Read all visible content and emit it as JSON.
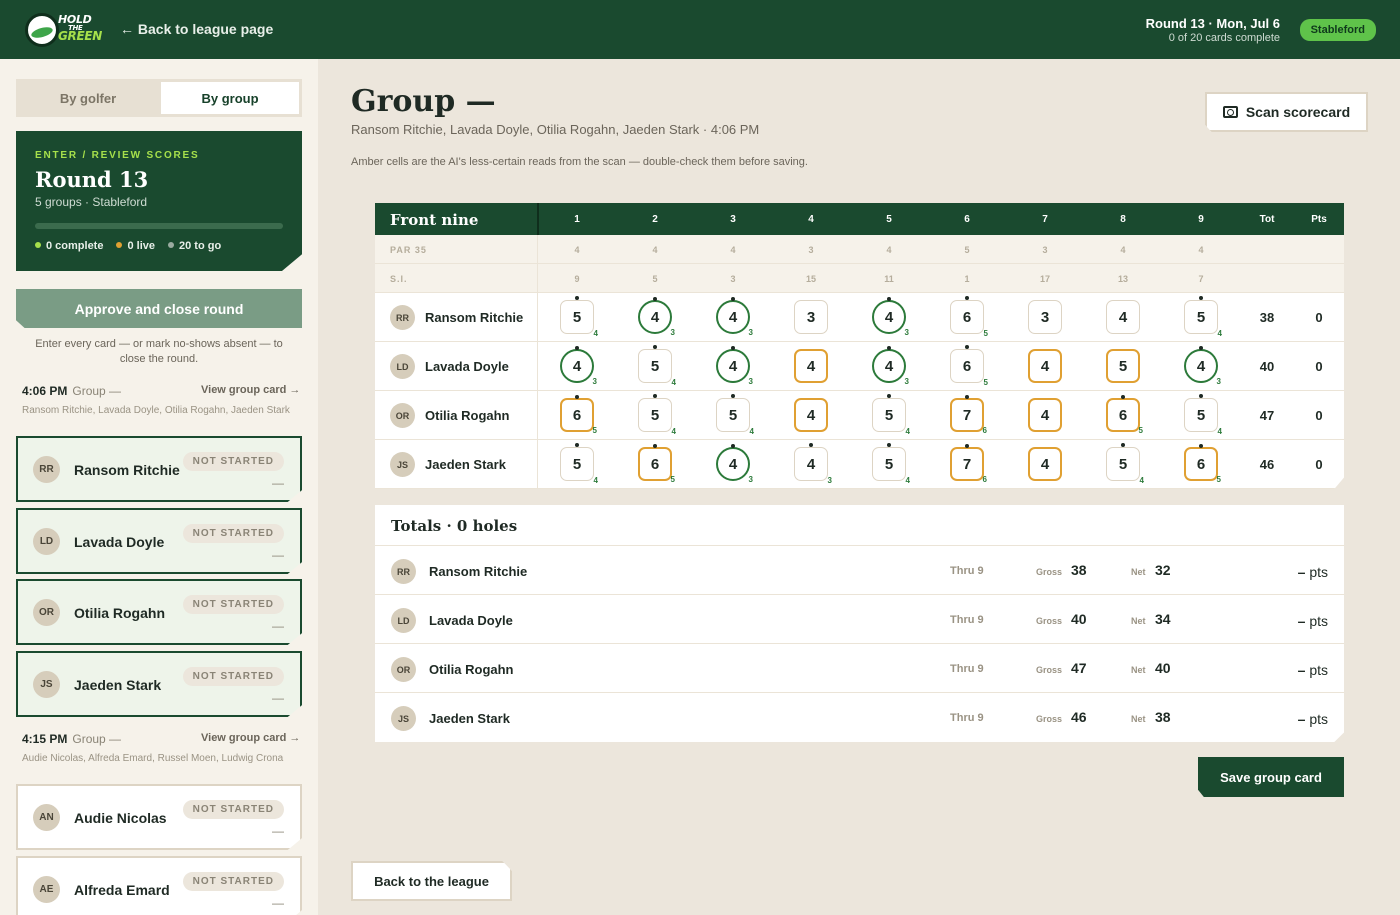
{
  "topbar": {
    "logo": {
      "line1": "HOLD",
      "line2": "THE",
      "line3": "GREEN"
    },
    "back_label": "← Back to league page",
    "round_title": "Round 13 · Mon, Jul 6",
    "round_sub": "0 of 20 cards complete",
    "format_pill": "Stableford"
  },
  "sidebar": {
    "tabs": [
      {
        "label": "By golfer",
        "selected": false
      },
      {
        "label": "By group",
        "selected": true
      }
    ],
    "round_card": {
      "kicker": "ENTER / REVIEW SCORES",
      "title": "Round 13",
      "subtitle": "5 groups · Stableford",
      "progress": 0,
      "stats": [
        {
          "label": "0 complete",
          "color": "#a6e04b"
        },
        {
          "label": "0 live",
          "color": "#e0a032"
        },
        {
          "label": "20 to go",
          "color": "#9aaba0"
        }
      ]
    },
    "approve_label": "Approve and close round",
    "approve_note": "Enter every card — or mark no-shows absent — to close the round.",
    "groups": [
      {
        "time": "4:06 PM",
        "label": "Group —",
        "view": "View group card →",
        "names": "Ransom Ritchie, Lavada Doyle, Otilia Rogahn, Jaeden Stark",
        "players": [
          {
            "initials": "RR",
            "name": "Ransom Ritchie",
            "status": "NOT STARTED",
            "dash": "—"
          },
          {
            "initials": "LD",
            "name": "Lavada Doyle",
            "status": "NOT STARTED",
            "dash": "—"
          },
          {
            "initials": "OR",
            "name": "Otilia Rogahn",
            "status": "NOT STARTED",
            "dash": "—"
          },
          {
            "initials": "JS",
            "name": "Jaeden Stark",
            "status": "NOT STARTED",
            "dash": "—"
          }
        ]
      },
      {
        "time": "4:15 PM",
        "label": "Group —",
        "view": "View group card →",
        "names": "Audie Nicolas, Alfreda Emard, Russel Moen, Ludwig Crona",
        "players": [
          {
            "initials": "AN",
            "name": "Audie Nicolas",
            "status": "NOT STARTED",
            "dash": "—"
          },
          {
            "initials": "AE",
            "name": "Alfreda Emard",
            "status": "NOT STARTED",
            "dash": "—"
          }
        ]
      }
    ]
  },
  "main": {
    "title": "Group —",
    "subtitle": "Ransom Ritchie, Lavada Doyle, Otilia Rogahn, Jaeden Stark · 4:06 PM",
    "note": "Amber cells are the AI's less-certain reads from the scan — double-check them before saving.",
    "scan_label": "Scan scorecard",
    "scorecard": {
      "section": "Front nine",
      "holes": [
        "1",
        "2",
        "3",
        "4",
        "5",
        "6",
        "7",
        "8",
        "9"
      ],
      "tot_label": "Tot",
      "pts_label": "Pts",
      "par_label": "PAR 35",
      "pars": [
        "4",
        "4",
        "4",
        "3",
        "4",
        "5",
        "3",
        "4",
        "4"
      ],
      "si_label": "S.I.",
      "si": [
        "9",
        "5",
        "3",
        "15",
        "11",
        "1",
        "17",
        "13",
        "7"
      ],
      "players": [
        {
          "initials": "RR",
          "name": "Ransom Ritchie",
          "tot": "38",
          "pts": "0",
          "scores": [
            {
              "v": "5",
              "style": "plain",
              "dot": true,
              "sub": "4"
            },
            {
              "v": "4",
              "style": "circle",
              "dot": true,
              "sub": "3"
            },
            {
              "v": "4",
              "style": "circle",
              "dot": true,
              "sub": "3"
            },
            {
              "v": "3",
              "style": "plain",
              "dot": false,
              "sub": ""
            },
            {
              "v": "4",
              "style": "circle",
              "dot": true,
              "sub": "3"
            },
            {
              "v": "6",
              "style": "plain",
              "dot": true,
              "sub": "5"
            },
            {
              "v": "3",
              "style": "plain",
              "dot": false,
              "sub": ""
            },
            {
              "v": "4",
              "style": "plain",
              "dot": false,
              "sub": ""
            },
            {
              "v": "5",
              "style": "plain",
              "dot": true,
              "sub": "4"
            }
          ]
        },
        {
          "initials": "LD",
          "name": "Lavada Doyle",
          "tot": "40",
          "pts": "0",
          "scores": [
            {
              "v": "4",
              "style": "circle",
              "dot": true,
              "sub": "3"
            },
            {
              "v": "5",
              "style": "plain",
              "dot": true,
              "sub": "4"
            },
            {
              "v": "4",
              "style": "circle",
              "dot": true,
              "sub": "3"
            },
            {
              "v": "4",
              "style": "amber",
              "dot": false,
              "sub": ""
            },
            {
              "v": "4",
              "style": "circle",
              "dot": true,
              "sub": "3"
            },
            {
              "v": "6",
              "style": "plain",
              "dot": true,
              "sub": "5"
            },
            {
              "v": "4",
              "style": "amber",
              "dot": false,
              "sub": ""
            },
            {
              "v": "5",
              "style": "amber",
              "dot": false,
              "sub": ""
            },
            {
              "v": "4",
              "style": "circle",
              "dot": true,
              "sub": "3"
            }
          ]
        },
        {
          "initials": "OR",
          "name": "Otilia Rogahn",
          "tot": "47",
          "pts": "0",
          "scores": [
            {
              "v": "6",
              "style": "amber",
              "dot": true,
              "sub": "5"
            },
            {
              "v": "5",
              "style": "plain",
              "dot": true,
              "sub": "4"
            },
            {
              "v": "5",
              "style": "plain",
              "dot": true,
              "sub": "4"
            },
            {
              "v": "4",
              "style": "amber",
              "dot": false,
              "sub": ""
            },
            {
              "v": "5",
              "style": "plain",
              "dot": true,
              "sub": "4"
            },
            {
              "v": "7",
              "style": "amber",
              "dot": true,
              "sub": "6"
            },
            {
              "v": "4",
              "style": "amber",
              "dot": false,
              "sub": ""
            },
            {
              "v": "6",
              "style": "amber",
              "dot": true,
              "sub": "5"
            },
            {
              "v": "5",
              "style": "plain",
              "dot": true,
              "sub": "4"
            }
          ]
        },
        {
          "initials": "JS",
          "name": "Jaeden Stark",
          "tot": "46",
          "pts": "0",
          "scores": [
            {
              "v": "5",
              "style": "plain",
              "dot": true,
              "sub": "4"
            },
            {
              "v": "6",
              "style": "amber",
              "dot": true,
              "sub": "5"
            },
            {
              "v": "4",
              "style": "circle",
              "dot": true,
              "sub": "3"
            },
            {
              "v": "4",
              "style": "plain",
              "dot": true,
              "sub": "3"
            },
            {
              "v": "5",
              "style": "plain",
              "dot": true,
              "sub": "4"
            },
            {
              "v": "7",
              "style": "amber",
              "dot": true,
              "sub": "6"
            },
            {
              "v": "4",
              "style": "amber",
              "dot": false,
              "sub": ""
            },
            {
              "v": "5",
              "style": "plain",
              "dot": true,
              "sub": "4"
            },
            {
              "v": "6",
              "style": "amber",
              "dot": true,
              "sub": "5"
            }
          ]
        }
      ]
    },
    "totals": {
      "title": "Totals · 0 holes",
      "gross_label": "Gross",
      "net_label": "Net",
      "pts_suffix": "pts",
      "rows": [
        {
          "initials": "RR",
          "name": "Ransom Ritchie",
          "thru": "Thru 9",
          "gross": "38",
          "net": "32",
          "pts": "–"
        },
        {
          "initials": "LD",
          "name": "Lavada Doyle",
          "thru": "Thru 9",
          "gross": "40",
          "net": "34",
          "pts": "–"
        },
        {
          "initials": "OR",
          "name": "Otilia Rogahn",
          "thru": "Thru 9",
          "gross": "47",
          "net": "40",
          "pts": "–"
        },
        {
          "initials": "JS",
          "name": "Jaeden Stark",
          "thru": "Thru 9",
          "gross": "46",
          "net": "38",
          "pts": "–"
        }
      ]
    },
    "save_label": "Save group card",
    "back_league_label": "Back to the league"
  },
  "colors": {
    "brand": "#1a4a2f",
    "accent": "#a6e04b",
    "amber": "#e0a032",
    "circle": "#2c7a3a"
  }
}
